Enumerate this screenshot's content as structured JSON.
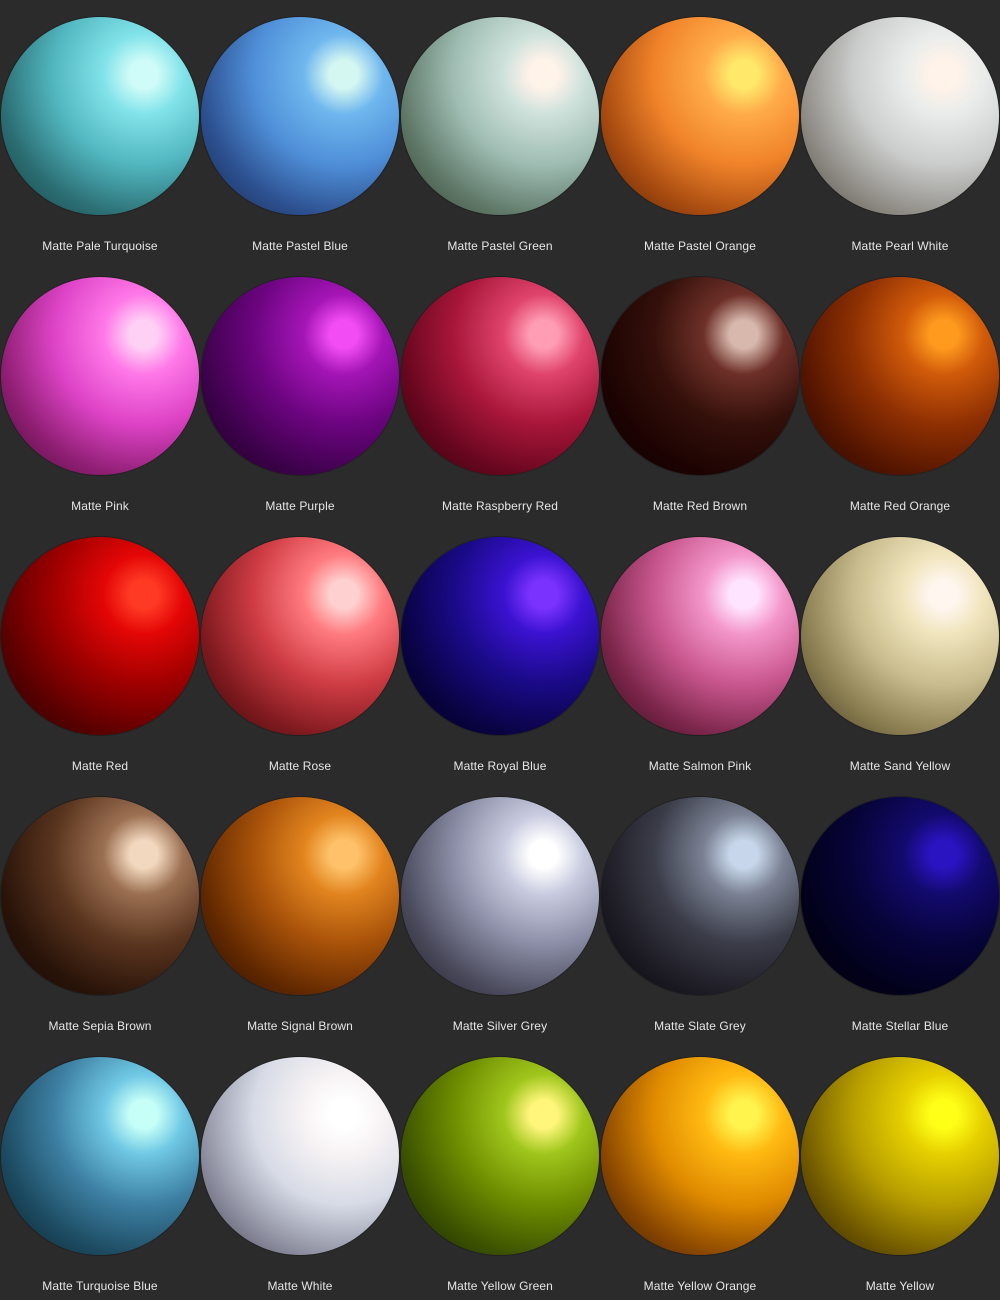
{
  "materials": [
    {
      "label": "Matte Pale Turquoise",
      "highlight": "#cffcf8",
      "light": "#82e3ea",
      "base": "#52b7c0",
      "dark": "#2b6e73",
      "shadow": "#153f41"
    },
    {
      "label": "Matte Pastel Blue",
      "highlight": "#d5f7f2",
      "light": "#6fb7ee",
      "base": "#4f8fd8",
      "dark": "#2c4f8e",
      "shadow": "#17284a"
    },
    {
      "label": "Matte Pastel Green",
      "highlight": "#fff3ea",
      "light": "#cfe2dc",
      "base": "#9fbdb3",
      "dark": "#5f7868",
      "shadow": "#34402e"
    },
    {
      "label": "Matte Pastel Orange",
      "highlight": "#ffe86a",
      "light": "#ffab4a",
      "base": "#f0832a",
      "dark": "#a64a10",
      "shadow": "#4c1e05"
    },
    {
      "label": "Matte Pearl White",
      "highlight": "#fff3ea",
      "light": "#e9eceb",
      "base": "#cbcdcc",
      "dark": "#8f8c86",
      "shadow": "#4b4740"
    },
    {
      "label": "Matte Pink",
      "highlight": "#ffd0f6",
      "light": "#ff78e8",
      "base": "#dd43c6",
      "dark": "#8e1e72",
      "shadow": "#42092f"
    },
    {
      "label": "Matte Purple",
      "highlight": "#f24cf5",
      "light": "#a415b6",
      "base": "#6c0480",
      "dark": "#3c014a",
      "shadow": "#16001c"
    },
    {
      "label": "Matte Raspberry Red",
      "highlight": "#ff9db4",
      "light": "#e0446c",
      "base": "#a8163a",
      "dark": "#66061e",
      "shadow": "#2c0209"
    },
    {
      "label": "Matte Red Brown",
      "highlight": "#d8b8ad",
      "light": "#6d3028",
      "base": "#34100a",
      "dark": "#1c0302",
      "shadow": "#0b0000"
    },
    {
      "label": "Matte Red Orange",
      "highlight": "#ff9a1e",
      "light": "#d15b0a",
      "base": "#8f3003",
      "dark": "#541500",
      "shadow": "#1f0500"
    },
    {
      "label": "Matte Red",
      "highlight": "#ff3a24",
      "light": "#e40606",
      "base": "#a00000",
      "dark": "#5a0000",
      "shadow": "#220000"
    },
    {
      "label": "Matte Rose",
      "highlight": "#ffd0d0",
      "light": "#ff7b7f",
      "base": "#cf3c44",
      "dark": "#7f1a1f",
      "shadow": "#320607"
    },
    {
      "label": "Matte Royal Blue",
      "highlight": "#7a32ff",
      "light": "#3a12d0",
      "base": "#190a86",
      "dark": "#090342",
      "shadow": "#030015"
    },
    {
      "label": "Matte Salmon Pink",
      "highlight": "#ffe4ff",
      "light": "#f396c9",
      "base": "#c9578f",
      "dark": "#7a2549",
      "shadow": "#2f0a19"
    },
    {
      "label": "Matte Sand Yellow",
      "highlight": "#fff6ef",
      "light": "#f0e5bd",
      "base": "#c9bd8e",
      "dark": "#877b4f",
      "shadow": "#3f3420"
    },
    {
      "label": "Matte Sepia Brown",
      "highlight": "#f2d8be",
      "light": "#9c7052",
      "base": "#5a351f",
      "dark": "#2a1409",
      "shadow": "#0e0402"
    },
    {
      "label": "Matte Signal Brown",
      "highlight": "#ffc26a",
      "light": "#e2851f",
      "base": "#a8520a",
      "dark": "#612800",
      "shadow": "#260c00"
    },
    {
      "label": "Matte Silver Grey",
      "highlight": "#ffffff",
      "light": "#c9cce0",
      "base": "#8b8ea6",
      "dark": "#4a4a5c",
      "shadow": "#1a1a22"
    },
    {
      "label": "Matte Slate Grey",
      "highlight": "#c7d6ea",
      "light": "#7b8294",
      "base": "#3a3c48",
      "dark": "#1c1a22",
      "shadow": "#07060a"
    },
    {
      "label": "Matte Stellar Blue",
      "highlight": "#2a13c0",
      "light": "#130a6e",
      "base": "#07043a",
      "dark": "#02011a",
      "shadow": "#000008"
    },
    {
      "label": "Matte Turquoise Blue",
      "highlight": "#c6fff8",
      "light": "#6fc8e4",
      "base": "#3d7fa2",
      "dark": "#1c4a60",
      "shadow": "#0b1f28"
    },
    {
      "label": "Matte White",
      "highlight": "#ffffff",
      "light": "#f7f3f4",
      "base": "#d7dbe6",
      "dark": "#8d8fa0",
      "shadow": "#3d3b48"
    },
    {
      "label": "Matte Yellow Green",
      "highlight": "#fff67b",
      "light": "#9fc61c",
      "base": "#6f8d00",
      "dark": "#3c5200",
      "shadow": "#162000"
    },
    {
      "label": "Matte Yellow Orange",
      "highlight": "#fff34d",
      "light": "#ffba12",
      "base": "#e08b00",
      "dark": "#8a4700",
      "shadow": "#311600"
    },
    {
      "label": "Matte Yellow",
      "highlight": "#ffff18",
      "light": "#e6d000",
      "base": "#b89f00",
      "dark": "#705800",
      "shadow": "#251b00"
    }
  ]
}
